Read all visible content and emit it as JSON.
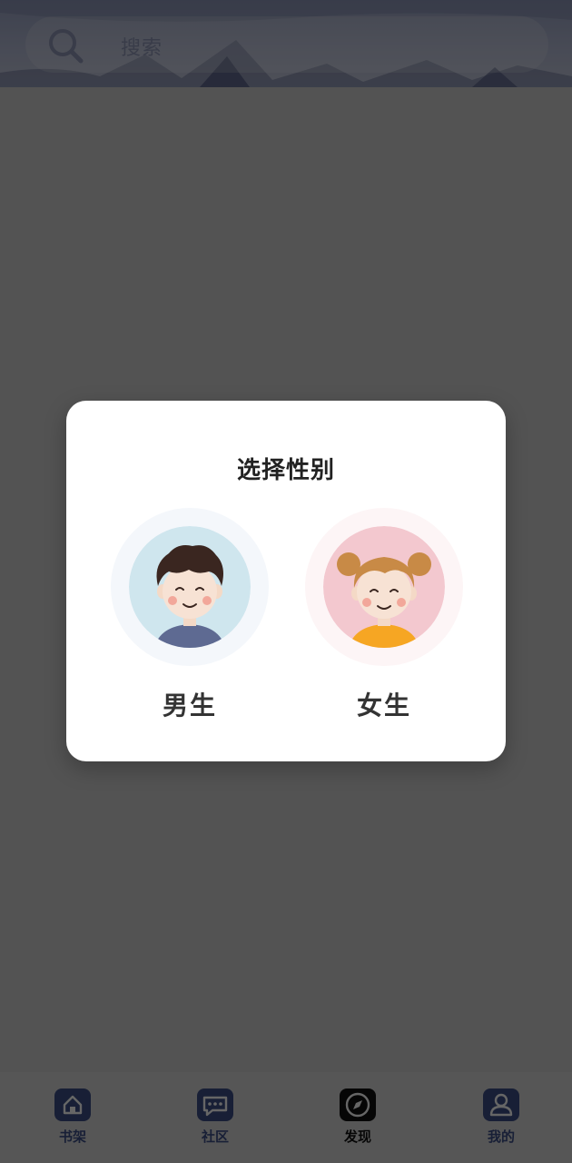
{
  "header": {
    "search": {
      "placeholder": "搜索",
      "icon": "search-icon"
    }
  },
  "bottom_nav": {
    "items": [
      {
        "label": "书架",
        "icon": "home-icon",
        "active": false
      },
      {
        "label": "社区",
        "icon": "chat-icon",
        "active": false
      },
      {
        "label": "发现",
        "icon": "compass-icon",
        "active": true
      },
      {
        "label": "我的",
        "icon": "user-icon",
        "active": false
      }
    ]
  },
  "modal": {
    "title": "选择性别",
    "options": [
      {
        "label": "男生",
        "avatar": "boy-avatar-icon"
      },
      {
        "label": "女生",
        "avatar": "girl-avatar-icon"
      }
    ]
  },
  "colors": {
    "nav_text": "#3d4f87",
    "nav_active_text": "#111111",
    "male_avatar_bg": "#cfe6ee",
    "female_avatar_bg": "#f3c8cf"
  }
}
